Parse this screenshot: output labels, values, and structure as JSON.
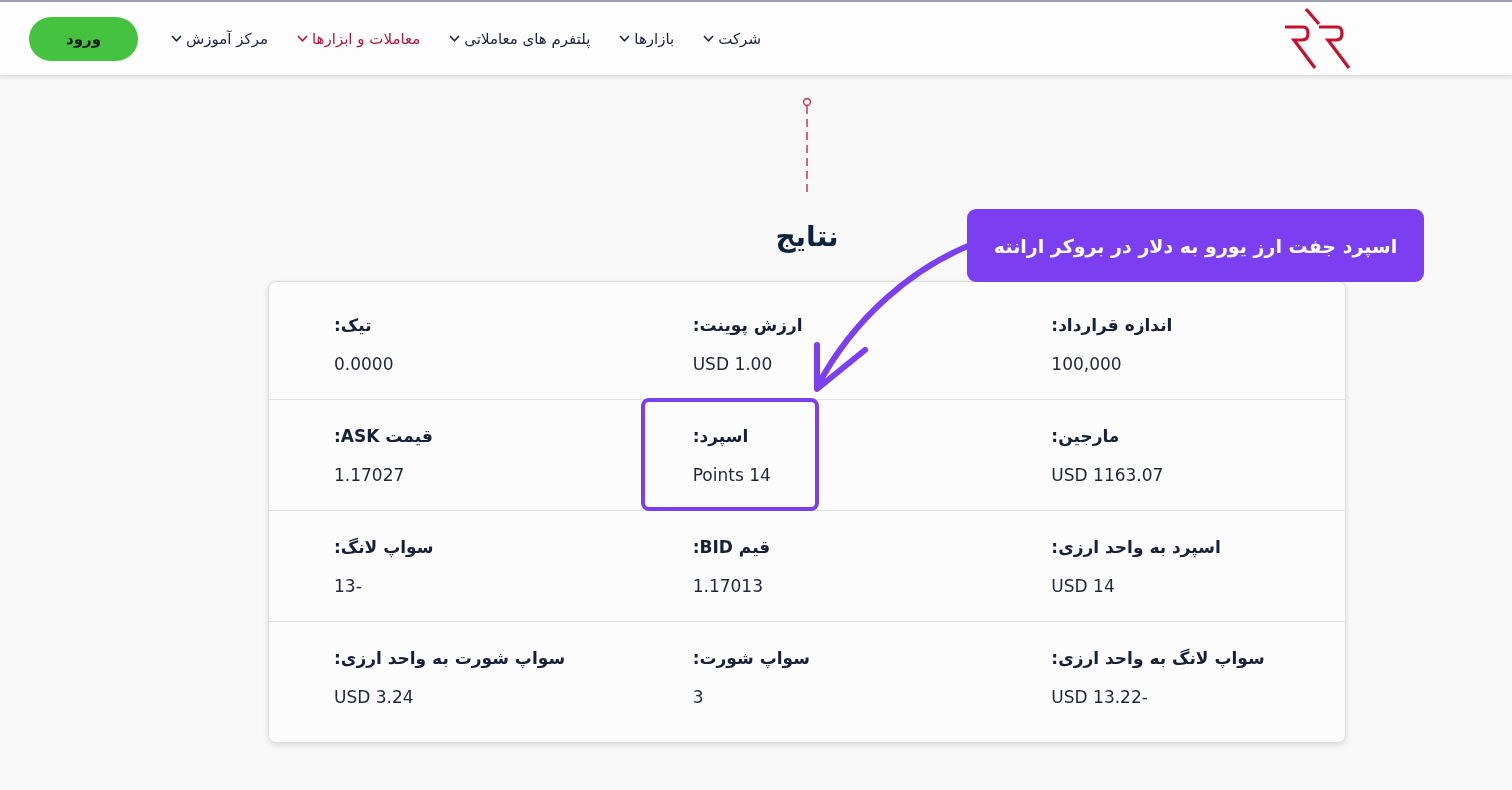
{
  "header": {
    "nav_items": [
      {
        "label": "شرکت",
        "selected": false
      },
      {
        "label": "بازارها",
        "selected": false
      },
      {
        "label": "پلتفرم های معاملاتی",
        "selected": false
      },
      {
        "label": "معاملات و ابزارها",
        "selected": true
      },
      {
        "label": "مرکز آموزش",
        "selected": false
      }
    ],
    "login_button": "ورود"
  },
  "results": {
    "title": "نتایج",
    "rows": [
      {
        "cells": [
          {
            "label": "اندازه قرارداد:",
            "value": "100,000",
            "highlighted": false
          },
          {
            "label": "ارزش پوینت:",
            "value": "USD 1.00",
            "highlighted": false
          },
          {
            "label": "تیک:",
            "value": "0.0000",
            "highlighted": false
          }
        ]
      },
      {
        "cells": [
          {
            "label": "مارجین:",
            "value": "USD 1163.07",
            "highlighted": false
          },
          {
            "label": "اسپرد:",
            "value": "Points 14",
            "highlighted": true
          },
          {
            "label": "قیمت ASK:",
            "value": "1.17027",
            "highlighted": false
          }
        ]
      },
      {
        "cells": [
          {
            "label": "اسپرد به واحد ارزی:",
            "value": "USD 14",
            "highlighted": false
          },
          {
            "label": "قیم BID:",
            "value": "1.17013",
            "highlighted": false
          },
          {
            "label": "سواپ لانگ:",
            "value": "13-",
            "highlighted": false
          }
        ]
      },
      {
        "cells": [
          {
            "label": "سواپ لانگ به واحد ارزی:",
            "value": "USD 13.22-",
            "highlighted": false
          },
          {
            "label": "سواپ شورت:",
            "value": "3",
            "highlighted": false
          },
          {
            "label": "سواپ شورت به واحد ارزی:",
            "value": "USD 3.24",
            "highlighted": false
          }
        ]
      }
    ]
  },
  "annotation": {
    "text": "اسپرد جفت ارز یورو به دلار در بروکر ارانته"
  }
}
